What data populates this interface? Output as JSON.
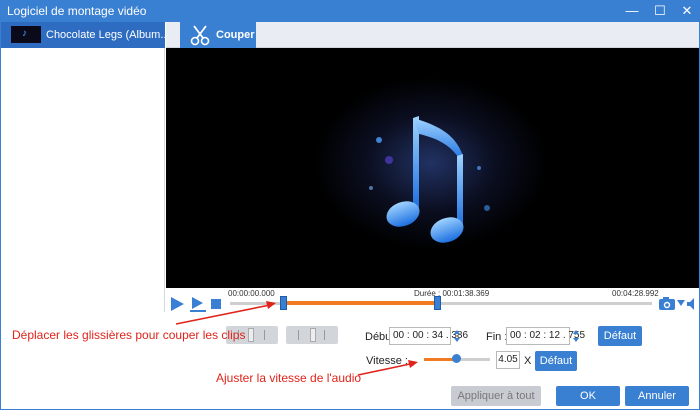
{
  "window": {
    "title": "Logiciel de montage vidéo",
    "minimize_glyph": "—",
    "maximize_glyph": "☐",
    "close_glyph": "✕"
  },
  "clip": {
    "name": "Chocolate Legs (Album...",
    "thumb_icon": "music-note-icon"
  },
  "tab": {
    "label": "Couper",
    "icon": "scissors-icon"
  },
  "timeline": {
    "start_time": "00:00:00.000",
    "duration": "Durée : 00:01:38.369",
    "end_time": "00:04:28.992",
    "selection_start_fraction": 0.126,
    "selection_end_fraction": 0.49
  },
  "controls": {
    "play_icon": "play-icon",
    "play_clip_icon": "play-clip-icon",
    "stop_icon": "stop-icon",
    "snapshot_icon": "camera-icon",
    "volume_icon": "volume-icon"
  },
  "cut": {
    "start_label": "Début",
    "start_value": "00 : 00 : 34 . 386",
    "end_label": "Fin :",
    "end_value": "00 : 02 : 12 . 755",
    "default_button": "Défaut"
  },
  "speed": {
    "label": "Vitesse :",
    "value": "4.05",
    "unit": "X",
    "slider_fraction": 0.48,
    "default_button": "Défaut"
  },
  "footer": {
    "apply_all": "Appliquer à tout",
    "ok": "OK",
    "cancel": "Annuler"
  },
  "annotations": {
    "slider_hint": "Déplacer les glissières pour couper les clips",
    "speed_hint": "Ajuster la vitesse de l'audio"
  },
  "colors": {
    "accent": "#3a80d2",
    "selection": "#f07b22",
    "annotation": "#e0241b"
  }
}
